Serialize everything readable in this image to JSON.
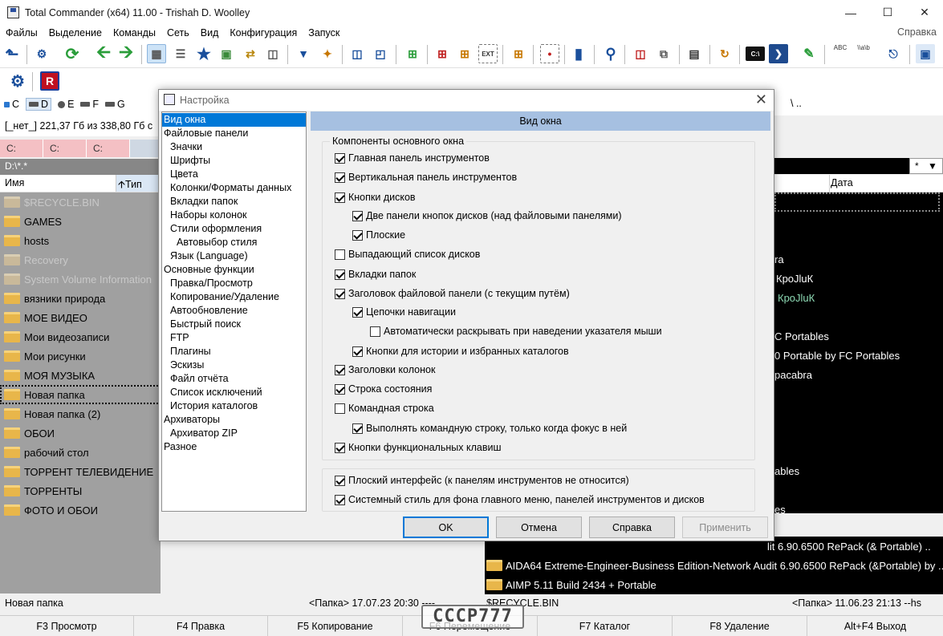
{
  "window": {
    "title": "Total Commander (x64) 11.00 - Trishah D. Woolley"
  },
  "menu": {
    "items": [
      "Файлы",
      "Выделение",
      "Команды",
      "Сеть",
      "Вид",
      "Конфигурация",
      "Запуск"
    ],
    "help": "Справка"
  },
  "toolbar": {
    "icons": [
      "back-icon",
      "settings-icon",
      "refresh-icon",
      "arrow-left-icon",
      "arrow-right-icon",
      "brief-view-icon",
      "detailed-view-icon",
      "favorites-icon",
      "thumbnails-icon",
      "sync-icon",
      "compare-icon",
      "filter-icon",
      "wizard-icon",
      "panel-icon",
      "panel-maximize-icon",
      "new-folder-icon",
      "new-file-icon",
      "new-folder-from-icon",
      "ext-icon",
      "new-copy-icon",
      "invert-icon",
      "chart-icon",
      "search-icon",
      "multi-rename-icon",
      "copy-names-icon",
      "view-file-icon",
      "folder-sync-icon",
      "cmd-icon",
      "powershell-icon",
      "notepad-icon",
      "abc-icon",
      "path-icon",
      "exit-icon",
      "system-icon"
    ],
    "cmd_label": "C:\\",
    "abc_label": "ABC",
    "path_label": "\\\\a\\b"
  },
  "toolbar2": {
    "icons": [
      "gear-icon",
      "r-app-icon"
    ]
  },
  "left": {
    "drives": [
      {
        "letter": "C",
        "selected": false
      },
      {
        "letter": "D",
        "selected": true
      },
      {
        "letter": "E",
        "selected": false
      },
      {
        "letter": "F",
        "selected": false
      },
      {
        "letter": "G",
        "selected": false
      }
    ],
    "free_info": "[_нет_]   221,37 Гб из 338,80 Гб с",
    "tabs": [
      "C:",
      "C:",
      "C:"
    ],
    "path": "D:\\*.*",
    "header": {
      "name": "Имя",
      "type": "Тип"
    },
    "files": [
      {
        "name": "$RECYCLE.BIN",
        "hidden": true
      },
      {
        "name": "GAMES",
        "hidden": false
      },
      {
        "name": "hosts",
        "hidden": false
      },
      {
        "name": "Recovery",
        "hidden": true
      },
      {
        "name": "System Volume Information",
        "hidden": true
      },
      {
        "name": "вязники природа",
        "hidden": false
      },
      {
        "name": "МОЕ ВИДЕО",
        "hidden": false
      },
      {
        "name": "Мои видеозаписи",
        "hidden": false
      },
      {
        "name": "Мои рисунки",
        "hidden": false
      },
      {
        "name": "МОЯ МУЗЫКА",
        "hidden": false
      },
      {
        "name": "Новая папка",
        "hidden": false,
        "current": true
      },
      {
        "name": "Новая папка (2)",
        "hidden": false
      },
      {
        "name": "ОБОИ",
        "hidden": false
      },
      {
        "name": "рабочий стол",
        "hidden": false
      },
      {
        "name": "ТОРРЕНТ ТЕЛЕВИДЕНИЕ",
        "hidden": false
      },
      {
        "name": "ТОРРЕНТЫ",
        "hidden": false
      },
      {
        "name": "ФОТО И ОБОИ",
        "hidden": false
      }
    ]
  },
  "right": {
    "nav": "\\   ..",
    "star": "*",
    "header": {
      "date": "Дата"
    },
    "partial_rows": [
      {
        "text": "ra",
        "color": "#ffffff"
      },
      {
        "text": "КроJluК",
        "color": "#ffffff"
      },
      {
        "text": "КроJluК",
        "color": "#8fdcb6"
      },
      {
        "text": "C Portables",
        "color": "#ffffff"
      },
      {
        "text": "0 Portable by FC Portables",
        "color": "#ffffff"
      },
      {
        "text": "pacabra",
        "color": "#ffffff"
      },
      {
        "text": "ables",
        "color": "#ffffff"
      },
      {
        "text": "es",
        "color": "#ffffff"
      }
    ],
    "bottom_rows": [
      "lit 6.90.6500 RePack (& Portable) ..",
      "AIDA64 Extreme-Engineer-Business Edition-Network Audit 6.90.6500 RePack (&Portable) by ..",
      "AIMP 5.11 Build 2434 + Portable"
    ]
  },
  "status": {
    "left_name": "Новая папка",
    "left_info": "<Папка> 17.07.23 20:30  ----",
    "right_name": "$RECYCLE.BIN",
    "right_info": "<Папка> 11.06.23 21:13  --hs"
  },
  "fkeys": [
    "F3 Просмотр",
    "F4 Правка",
    "F5 Копирование",
    "F6 Перемещение",
    "F7 Каталог",
    "F8 Удаление",
    "Alt+F4 Выход"
  ],
  "watermark": "СССР777",
  "dialog": {
    "title": "Настройка",
    "nav": [
      {
        "label": "Вид окна",
        "level": 0,
        "selected": true
      },
      {
        "label": "Файловые панели",
        "level": 0
      },
      {
        "label": "Значки",
        "level": 1
      },
      {
        "label": "Шрифты",
        "level": 1
      },
      {
        "label": "Цвета",
        "level": 1
      },
      {
        "label": "Колонки/Форматы данных",
        "level": 1
      },
      {
        "label": "Вкладки папок",
        "level": 1
      },
      {
        "label": "Наборы колонок",
        "level": 1
      },
      {
        "label": "Стили оформления",
        "level": 1
      },
      {
        "label": "Автовыбор стиля",
        "level": 2
      },
      {
        "label": "Язык (Language)",
        "level": 1
      },
      {
        "label": "Основные функции",
        "level": 0
      },
      {
        "label": "Правка/Просмотр",
        "level": 1
      },
      {
        "label": "Копирование/Удаление",
        "level": 1
      },
      {
        "label": "Автообновление",
        "level": 1
      },
      {
        "label": "Быстрый поиск",
        "level": 1
      },
      {
        "label": "FTP",
        "level": 1
      },
      {
        "label": "Плагины",
        "level": 1
      },
      {
        "label": "Эскизы",
        "level": 1
      },
      {
        "label": "Файл отчёта",
        "level": 1
      },
      {
        "label": "Список исключений",
        "level": 1
      },
      {
        "label": "История каталогов",
        "level": 1
      },
      {
        "label": "Архиваторы",
        "level": 0
      },
      {
        "label": "Архиватор ZIP",
        "level": 1
      },
      {
        "label": "Разное",
        "level": 0
      }
    ],
    "page_header": "Вид окна",
    "group_title": "Компоненты основного окна",
    "options": [
      {
        "label": "Главная панель инструментов",
        "checked": true,
        "indent": 0
      },
      {
        "label": "Вертикальная панель инструментов",
        "checked": true,
        "indent": 0
      },
      {
        "label": "Кнопки дисков",
        "checked": true,
        "indent": 0
      },
      {
        "label": "Две панели кнопок дисков (над файловыми панелями)",
        "checked": true,
        "indent": 1
      },
      {
        "label": "Плоские",
        "checked": true,
        "indent": 1
      },
      {
        "label": "Выпадающий список дисков",
        "checked": false,
        "indent": 0
      },
      {
        "label": "Вкладки папок",
        "checked": true,
        "indent": 0
      },
      {
        "label": "Заголовок файловой панели (с текущим путём)",
        "checked": true,
        "indent": 0
      },
      {
        "label": "Цепочки навигации",
        "checked": true,
        "indent": 1
      },
      {
        "label": "Автоматически раскрывать при наведении указателя мыши",
        "checked": false,
        "indent": 2
      },
      {
        "label": "Кнопки для истории и избранных каталогов",
        "checked": true,
        "indent": 1
      },
      {
        "label": "Заголовки колонок",
        "checked": true,
        "indent": 0
      },
      {
        "label": "Строка состояния",
        "checked": true,
        "indent": 0
      },
      {
        "label": "Командная строка",
        "checked": false,
        "indent": 0
      },
      {
        "label": "Выполнять командную строку, только когда фокус в ней",
        "checked": true,
        "indent": 1
      },
      {
        "label": "Кнопки функциональных клавиш",
        "checked": true,
        "indent": 0
      }
    ],
    "options2": [
      {
        "label": "Плоский интерфейс (к панелям инструментов не относится)",
        "checked": true
      },
      {
        "label": "Системный стиль для фона главного меню, панелей инструментов и дисков",
        "checked": true
      }
    ],
    "buttons": {
      "ok": "OK",
      "cancel": "Отмена",
      "help": "Справка",
      "apply": "Применить"
    }
  }
}
